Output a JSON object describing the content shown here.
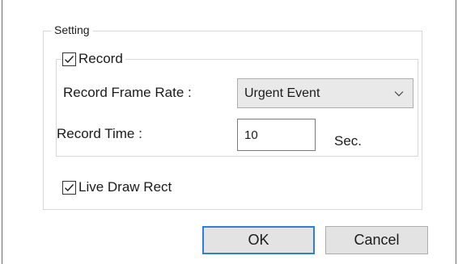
{
  "setting_group": {
    "title": "Setting",
    "record": {
      "label": "Record",
      "checked": true,
      "frame_rate": {
        "label": "Record Frame Rate :",
        "selected": "Urgent Event"
      },
      "record_time": {
        "label": "Record Time :",
        "value": "10",
        "unit": "Sec."
      }
    },
    "live_draw_rect": {
      "label": "Live Draw Rect",
      "checked": true
    }
  },
  "buttons": {
    "ok": "OK",
    "cancel": "Cancel"
  },
  "icons": {
    "checkbox_check": "check-icon",
    "dropdown_arrow": "chevron-down-icon"
  },
  "colors": {
    "default_button_border": "#2f7fd8",
    "button_face": "#e3e3e3",
    "group_border": "#d7d7d7"
  }
}
